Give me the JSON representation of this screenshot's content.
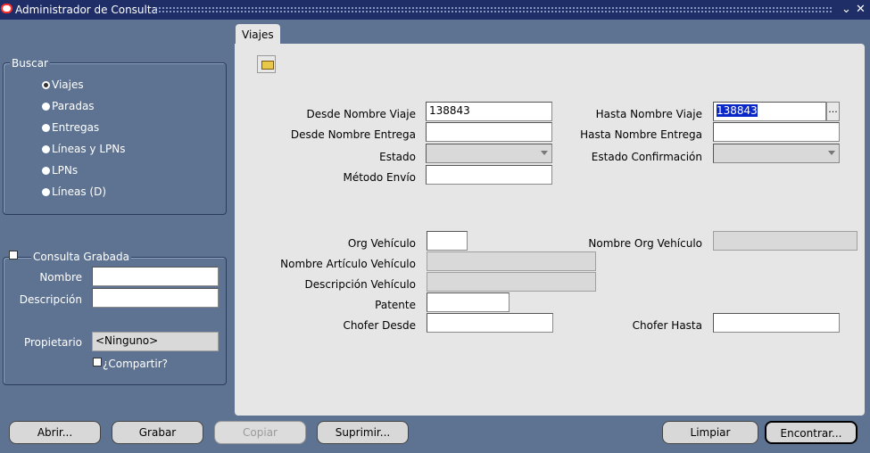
{
  "window": {
    "title": "Administrador de Consulta",
    "minimize": "⌄",
    "close": "✕"
  },
  "buscar": {
    "title": "Buscar",
    "options": [
      {
        "label": "Viajes",
        "selected": true
      },
      {
        "label": "Paradas",
        "selected": false
      },
      {
        "label": "Entregas",
        "selected": false
      },
      {
        "label": "Líneas y LPNs",
        "selected": false
      },
      {
        "label": "LPNs",
        "selected": false
      },
      {
        "label": "Líneas (D)",
        "selected": false
      }
    ]
  },
  "consulta": {
    "title": "Consulta Grabada",
    "nombre_label": "Nombre",
    "nombre_value": "",
    "descripcion_label": "Descripción",
    "descripcion_value": "",
    "propietario_label": "Propietario",
    "propietario_value": "<Ninguno>",
    "compartir_label": "¿Compartir?"
  },
  "tab": {
    "label": "Viajes"
  },
  "form": {
    "desde_nombre_viaje": {
      "label": "Desde Nombre Viaje",
      "value": "138843"
    },
    "hasta_nombre_viaje": {
      "label": "Hasta Nombre Viaje",
      "value": "138843"
    },
    "lov_button": "...",
    "desde_nombre_entrega": {
      "label": "Desde Nombre Entrega",
      "value": ""
    },
    "hasta_nombre_entrega": {
      "label": "Hasta Nombre Entrega",
      "value": ""
    },
    "estado": {
      "label": "Estado",
      "value": ""
    },
    "estado_confirmacion": {
      "label": "Estado Confirmación",
      "value": ""
    },
    "metodo_envio": {
      "label": "Método Envío",
      "value": ""
    },
    "org_vehiculo": {
      "label": "Org Vehículo",
      "value": ""
    },
    "nombre_org_vehiculo": {
      "label": "Nombre Org Vehículo",
      "value": ""
    },
    "nombre_articulo_vehiculo": {
      "label": "Nombre Artículo Vehículo",
      "value": ""
    },
    "descripcion_vehiculo": {
      "label": "Descripción Vehículo",
      "value": ""
    },
    "patente": {
      "label": "Patente",
      "value": ""
    },
    "chofer_desde": {
      "label": "Chofer Desde",
      "value": ""
    },
    "chofer_hasta": {
      "label": "Chofer Hasta",
      "value": ""
    }
  },
  "buttons": {
    "abrir": "Abrir...",
    "grabar": "Grabar",
    "copiar": "Copiar",
    "suprimir": "Suprimir...",
    "limpiar": "Limpiar",
    "encontrar": "Encontrar..."
  },
  "icons": {
    "app_logo": "oracle-logo-icon",
    "open_folder": "open-folder-icon"
  }
}
